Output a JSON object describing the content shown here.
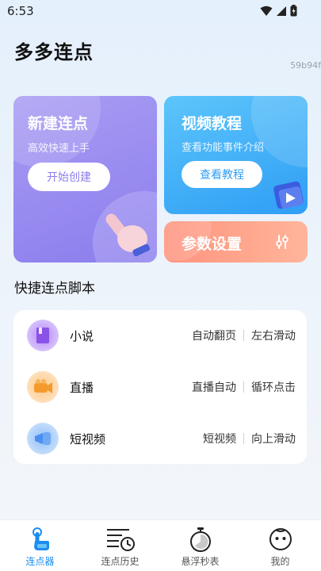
{
  "status_bar": {
    "time": "6:53"
  },
  "header": {
    "title": "多多连点",
    "device_code": "59b94f"
  },
  "cards": {
    "new_click": {
      "title": "新建连点",
      "subtitle": "高效快速上手",
      "button": "开始创建"
    },
    "video_tutorial": {
      "title": "视频教程",
      "subtitle": "查看功能事件介绍",
      "button": "查看教程"
    },
    "params": {
      "title": "参数设置"
    }
  },
  "quick_scripts": {
    "title": "快捷连点脚本",
    "items": [
      {
        "name": "小说",
        "tag1": "自动翻页",
        "tag2": "左右滑动",
        "icon": "book-icon",
        "color": "#9f76f3"
      },
      {
        "name": "直播",
        "tag1": "直播自动",
        "tag2": "循环点击",
        "icon": "camera-icon",
        "color": "#f7a958"
      },
      {
        "name": "短视频",
        "tag1": "短视频",
        "tag2": "向上滑动",
        "icon": "megaphone-icon",
        "color": "#6fa9f3"
      }
    ]
  },
  "bottom_nav": {
    "items": [
      {
        "label": "连点器",
        "icon": "tap-hand-icon",
        "active": true
      },
      {
        "label": "连点历史",
        "icon": "history-icon",
        "active": false
      },
      {
        "label": "悬浮秒表",
        "icon": "stopwatch-icon",
        "active": false
      },
      {
        "label": "我的",
        "icon": "profile-face-icon",
        "active": false
      }
    ]
  },
  "colors": {
    "accent": "#1b8cf0",
    "card_purple": "#9a8cf1",
    "card_blue": "#3aa8f7",
    "card_orange": "#ffa28a"
  }
}
